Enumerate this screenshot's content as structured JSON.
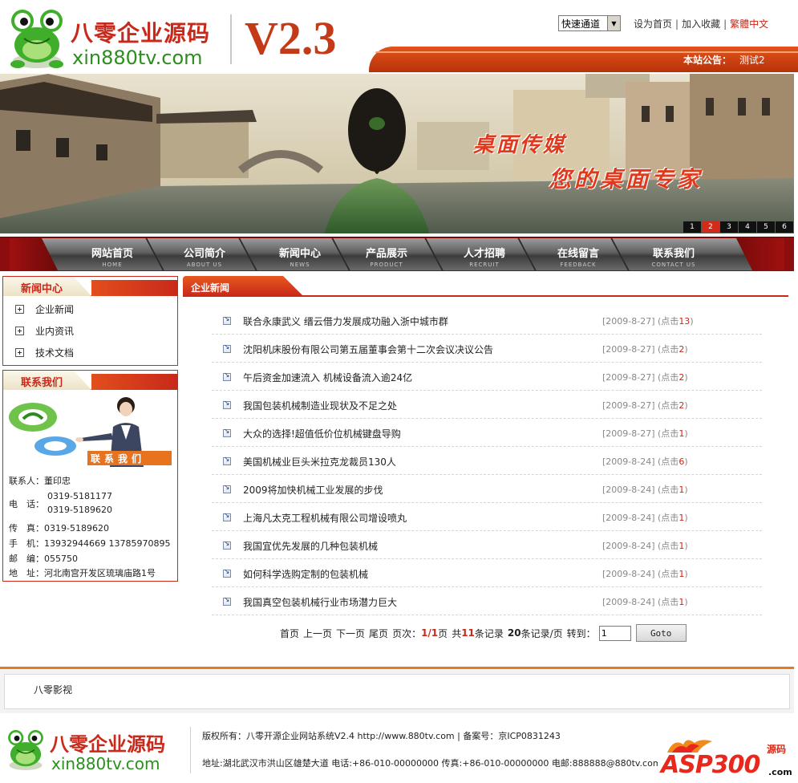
{
  "header": {
    "logo_cn": "八零企业源码",
    "logo_en": "xin880tv.com",
    "version": "V2.3",
    "quick_select": "快速通道",
    "links": [
      "设为首页",
      "加入收藏",
      "繁體中文"
    ],
    "notice_label": "本站公告：",
    "notice_text": "测试2"
  },
  "banner": {
    "slogan1": "桌面传媒",
    "slogan2": "您的桌面专家",
    "numbers": [
      "1",
      "2",
      "3",
      "4",
      "5",
      "6"
    ],
    "active": "2"
  },
  "nav": [
    {
      "cn": "网站首页",
      "en": "HOME"
    },
    {
      "cn": "公司简介",
      "en": "ABOUT US"
    },
    {
      "cn": "新闻中心",
      "en": "NEWS"
    },
    {
      "cn": "产品展示",
      "en": "PRODUCT"
    },
    {
      "cn": "人才招聘",
      "en": "RECRUIT"
    },
    {
      "cn": "在线留言",
      "en": "FEEDBACK"
    },
    {
      "cn": "联系我们",
      "en": "CONTACT US"
    }
  ],
  "sidebar": {
    "news_title": "新闻中心",
    "news_categories": [
      "企业新闻",
      "业内资讯",
      "技术文档"
    ],
    "contact_title": "联系我们",
    "contact_banner": "联系我们",
    "contact": {
      "person_label": "联系人：",
      "person": "董印忠",
      "phone_label": "电　话：",
      "phone1": "0319-5181177",
      "phone2": "0319-5189620",
      "fax_label": "传　真：",
      "fax": "0319-5189620",
      "mobile_label": "手　机：",
      "mobile": "13932944669 13785970895",
      "zip_label": "邮　编：",
      "zip": "055750",
      "address_label": "地　址：",
      "address": "河北南宫开发区琉璃庙路1号"
    }
  },
  "main": {
    "tab_title": "企业新闻",
    "hits_prefix": "(点击",
    "hits_suffix": ")",
    "news": [
      {
        "title": "联合永康武义 缙云借力发展成功融入浙中城市群",
        "date": "[2009-8-27]",
        "hits": "13"
      },
      {
        "title": "沈阳机床股份有限公司第五届董事会第十二次会议决议公告",
        "date": "[2009-8-27]",
        "hits": "2"
      },
      {
        "title": "午后资金加速流入 机械设备流入逾24亿",
        "date": "[2009-8-27]",
        "hits": "2"
      },
      {
        "title": "我国包装机械制造业现状及不足之处",
        "date": "[2009-8-27]",
        "hits": "2"
      },
      {
        "title": "大众的选择!超值低价位机械键盘导购",
        "date": "[2009-8-27]",
        "hits": "1"
      },
      {
        "title": "美国机械业巨头米拉克龙裁员130人",
        "date": "[2009-8-24]",
        "hits": "6"
      },
      {
        "title": "2009将加快机械工业发展的步伐",
        "date": "[2009-8-24]",
        "hits": "1"
      },
      {
        "title": "上海凡太克工程机械有限公司增设喷丸",
        "date": "[2009-8-24]",
        "hits": "1"
      },
      {
        "title": "我国宜优先发展的几种包装机械",
        "date": "[2009-8-24]",
        "hits": "1"
      },
      {
        "title": "如何科学选购定制的包装机械",
        "date": "[2009-8-24]",
        "hits": "1"
      },
      {
        "title": "我国真空包装机械行业市场潜力巨大",
        "date": "[2009-8-24]",
        "hits": "1"
      }
    ]
  },
  "pager": {
    "first": "首页",
    "prev": "上一页",
    "next": "下一页",
    "last": "尾页",
    "page_label": "页次：",
    "page_current": "1/1",
    "page_unit": "页",
    "total_prefix": "共",
    "total": "11",
    "total_suffix": "条记录",
    "per_page": "20",
    "per_page_suffix": "条记录/页",
    "goto_label": "转到：",
    "goto_value": "1",
    "goto_button": "Goto"
  },
  "friend_links": {
    "text": "八零影视"
  },
  "footer": {
    "logo_cn": "八零企业源码",
    "logo_en": "xin880tv.com",
    "line1": "版权所有：八零开源企业网站系统V2.4  http://www.880tv.com  | 备案号：京ICP0831243",
    "line2": "地址:湖北武汉市洪山区雄楚大道 电话:+86-010-00000000  传真:+86-010-00000000 电邮:888888@880tv.com",
    "asp_text": "ASP300",
    "asp_sub": "源码",
    "asp_com": ".com"
  },
  "colors": {
    "brand_red": "#c8291a",
    "brand_orange": "#e1541a",
    "logo_green": "#2a8f1c",
    "nav_dark_red": "#8b0d0d"
  }
}
